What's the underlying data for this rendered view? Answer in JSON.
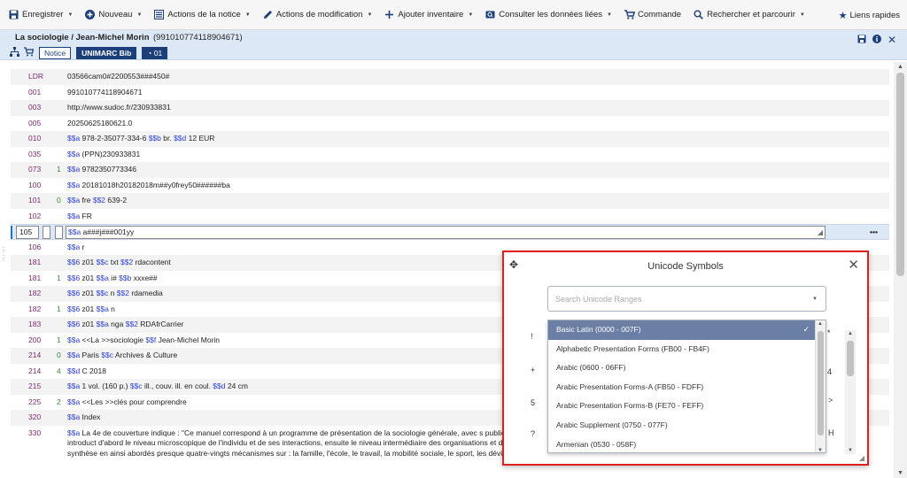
{
  "toolbar": {
    "items": [
      {
        "label": "Enregistrer",
        "icon": "save-icon",
        "caret": true
      },
      {
        "label": "Nouveau",
        "icon": "plus-circle-icon",
        "caret": true
      },
      {
        "label": "Actions de la notice",
        "icon": "list-icon",
        "caret": true
      },
      {
        "label": "Actions de modification",
        "icon": "pencil-icon",
        "caret": true
      },
      {
        "label": "Ajouter inventaire",
        "icon": "plus-icon",
        "caret": true
      },
      {
        "label": "Consulter les données liées",
        "icon": "linked-data-icon",
        "caret": true
      },
      {
        "label": "Commande",
        "icon": "cart-icon",
        "caret": false
      },
      {
        "label": "Rechercher et parcourir",
        "icon": "search-icon",
        "caret": true
      }
    ],
    "quick_links": "Liens rapides"
  },
  "record": {
    "title": "La sociologie / Jean-Michel Morin",
    "id": "(991010774118904671)",
    "badge_notice": "Notice",
    "badge_format": "UNIMARC Bib",
    "badge_count": "01"
  },
  "fields": [
    {
      "tag": "LDR",
      "ind1": "",
      "ind2": "",
      "value": [
        [
          "t",
          "03566cam0#2200553###450#"
        ]
      ]
    },
    {
      "tag": "001",
      "ind1": "",
      "ind2": "",
      "value": [
        [
          "t",
          "991010774118904671"
        ]
      ]
    },
    {
      "tag": "003",
      "ind1": "",
      "ind2": "",
      "value": [
        [
          "t",
          "http://www.sudoc.fr/230933831"
        ]
      ]
    },
    {
      "tag": "005",
      "ind1": "",
      "ind2": "",
      "value": [
        [
          "t",
          "20250625180621.0"
        ]
      ]
    },
    {
      "tag": "010",
      "ind1": "",
      "ind2": "",
      "value": [
        [
          "s",
          "$$a"
        ],
        [
          "t",
          " 978-2-35077-334-6 "
        ],
        [
          "s",
          "$$b"
        ],
        [
          "t",
          " br. "
        ],
        [
          "s",
          "$$d"
        ],
        [
          "t",
          " 12 EUR"
        ]
      ]
    },
    {
      "tag": "035",
      "ind1": "",
      "ind2": "",
      "value": [
        [
          "s",
          "$$a"
        ],
        [
          "t",
          " (PPN)230933831"
        ]
      ]
    },
    {
      "tag": "073",
      "ind1": "1",
      "ind2": "",
      "value": [
        [
          "s",
          "$$a"
        ],
        [
          "t",
          " 9782350773346"
        ]
      ]
    },
    {
      "tag": "100",
      "ind1": "",
      "ind2": "",
      "value": [
        [
          "s",
          "$$a"
        ],
        [
          "t",
          " 20181018h20182018m##y0frey50######ba"
        ]
      ]
    },
    {
      "tag": "101",
      "ind1": "0",
      "ind2": "",
      "value": [
        [
          "s",
          "$$a"
        ],
        [
          "t",
          " fre "
        ],
        [
          "s",
          "$$2"
        ],
        [
          "t",
          " 639-2"
        ]
      ]
    },
    {
      "tag": "102",
      "ind1": "",
      "ind2": "",
      "value": [
        [
          "s",
          "$$a"
        ],
        [
          "t",
          " FR"
        ]
      ]
    },
    {
      "tag": "105",
      "ind1": "",
      "ind2": "",
      "editing": true,
      "value": [
        [
          "s",
          "$$a"
        ],
        [
          "t",
          " a###j###001yy"
        ]
      ]
    },
    {
      "tag": "106",
      "ind1": "",
      "ind2": "",
      "value": [
        [
          "s",
          "$$a"
        ],
        [
          "t",
          " r"
        ]
      ]
    },
    {
      "tag": "181",
      "ind1": "",
      "ind2": "",
      "value": [
        [
          "s",
          "$$6"
        ],
        [
          "t",
          " z01 "
        ],
        [
          "s",
          "$$c"
        ],
        [
          "t",
          " txt "
        ],
        [
          "s",
          "$$2"
        ],
        [
          "t",
          " rdacontent"
        ]
      ]
    },
    {
      "tag": "181",
      "ind1": "1",
      "ind2": "",
      "value": [
        [
          "s",
          "$$6"
        ],
        [
          "t",
          " z01 "
        ],
        [
          "s",
          "$$a"
        ],
        [
          "t",
          " i# "
        ],
        [
          "s",
          "$$b"
        ],
        [
          "t",
          " xxxe##"
        ]
      ]
    },
    {
      "tag": "182",
      "ind1": "",
      "ind2": "",
      "value": [
        [
          "s",
          "$$6"
        ],
        [
          "t",
          " z01 "
        ],
        [
          "s",
          "$$c"
        ],
        [
          "t",
          " n "
        ],
        [
          "s",
          "$$2"
        ],
        [
          "t",
          " rdamedia"
        ]
      ]
    },
    {
      "tag": "182",
      "ind1": "1",
      "ind2": "",
      "value": [
        [
          "s",
          "$$6"
        ],
        [
          "t",
          " z01 "
        ],
        [
          "s",
          "$$a"
        ],
        [
          "t",
          " n"
        ]
      ]
    },
    {
      "tag": "183",
      "ind1": "",
      "ind2": "",
      "value": [
        [
          "s",
          "$$6"
        ],
        [
          "t",
          " z01 "
        ],
        [
          "s",
          "$$a"
        ],
        [
          "t",
          " nga "
        ],
        [
          "s",
          "$$2"
        ],
        [
          "t",
          " RDAfrCarrier"
        ]
      ]
    },
    {
      "tag": "200",
      "ind1": "1",
      "ind2": "",
      "value": [
        [
          "s",
          "$$a"
        ],
        [
          "t",
          " <<La >>sociologie "
        ],
        [
          "s",
          "$$f"
        ],
        [
          "t",
          " Jean-Michel Morin"
        ]
      ]
    },
    {
      "tag": "214",
      "ind1": "",
      "ind2": "0",
      "value": [
        [
          "s",
          "$$a"
        ],
        [
          "t",
          " Paris "
        ],
        [
          "s",
          "$$c"
        ],
        [
          "t",
          " Archives & Culture"
        ]
      ]
    },
    {
      "tag": "214",
      "ind1": "",
      "ind2": "4",
      "value": [
        [
          "s",
          "$$d"
        ],
        [
          "t",
          " C 2018"
        ]
      ]
    },
    {
      "tag": "215",
      "ind1": "",
      "ind2": "",
      "value": [
        [
          "s",
          "$$a"
        ],
        [
          "t",
          " 1 vol. (160 p.) "
        ],
        [
          "s",
          "$$c"
        ],
        [
          "t",
          " ill., couv. ill. en coul. "
        ],
        [
          "s",
          "$$d"
        ],
        [
          "t",
          " 24 cm"
        ]
      ]
    },
    {
      "tag": "225",
      "ind1": "2",
      "ind2": "",
      "value": [
        [
          "s",
          "$$a"
        ],
        [
          "t",
          " <<Les >>clés pour comprendre"
        ]
      ]
    },
    {
      "tag": "320",
      "ind1": "",
      "ind2": "",
      "value": [
        [
          "s",
          "$$a"
        ],
        [
          "t",
          " Index"
        ]
      ]
    },
    {
      "tag": "330",
      "ind1": "",
      "ind2": "",
      "multiline": true,
      "value": [
        [
          "s",
          "$$a"
        ],
        [
          "t",
          " La 4e de couverture indique : \"Ce manuel correspond à un programme de présentation de la sociologie générale, avec s                                                                                                                    publics variés : licence, terminale, IUT, master, diplôme universitaire, préparation à l'agrégation de SES. Après une introduct                                                                                                                    d'abord le niveau microscopique de l'individu et de ses interactions, ensuite le niveau intermédiaire des organisations et des                                                                                                                    des croyances. Chaque concept est déployé sur une double-page, avec : à gauche une accroche, puis une synthèse en                                                                                                                    ainsi abordés presque quatre-vingts mécanismes sur : la famille, l'école, le travail, la mobilité sociale, le sport, les déviances, les relations de pouvoirs, les âges de la vie, la pauvreté, les élites, le politique, le"
        ]
      ]
    }
  ],
  "modal": {
    "title": "Unicode Symbols",
    "search_placeholder": "Search Unicode Ranges",
    "options": [
      {
        "label": "Basic Latin (0000 - 007F)",
        "selected": true
      },
      {
        "label": "Alphabetic Presentation Forms (FB00 - FB4F)",
        "selected": false
      },
      {
        "label": "Arabic (0600 - 06FF)",
        "selected": false
      },
      {
        "label": "Arabic Presentation Forms-A (FB50 - FDFF)",
        "selected": false
      },
      {
        "label": "Arabic Presentation Forms-B (FE70 - FEFF)",
        "selected": false
      },
      {
        "label": "Arabic Supplement (0750 - 077F)",
        "selected": false
      },
      {
        "label": "Armenian (0530 - 058F)",
        "selected": false
      }
    ],
    "bg_chars_left": [
      "!",
      "+",
      "5",
      "?"
    ],
    "bg_chars_right": [
      "*",
      "4",
      ">",
      "H"
    ]
  }
}
